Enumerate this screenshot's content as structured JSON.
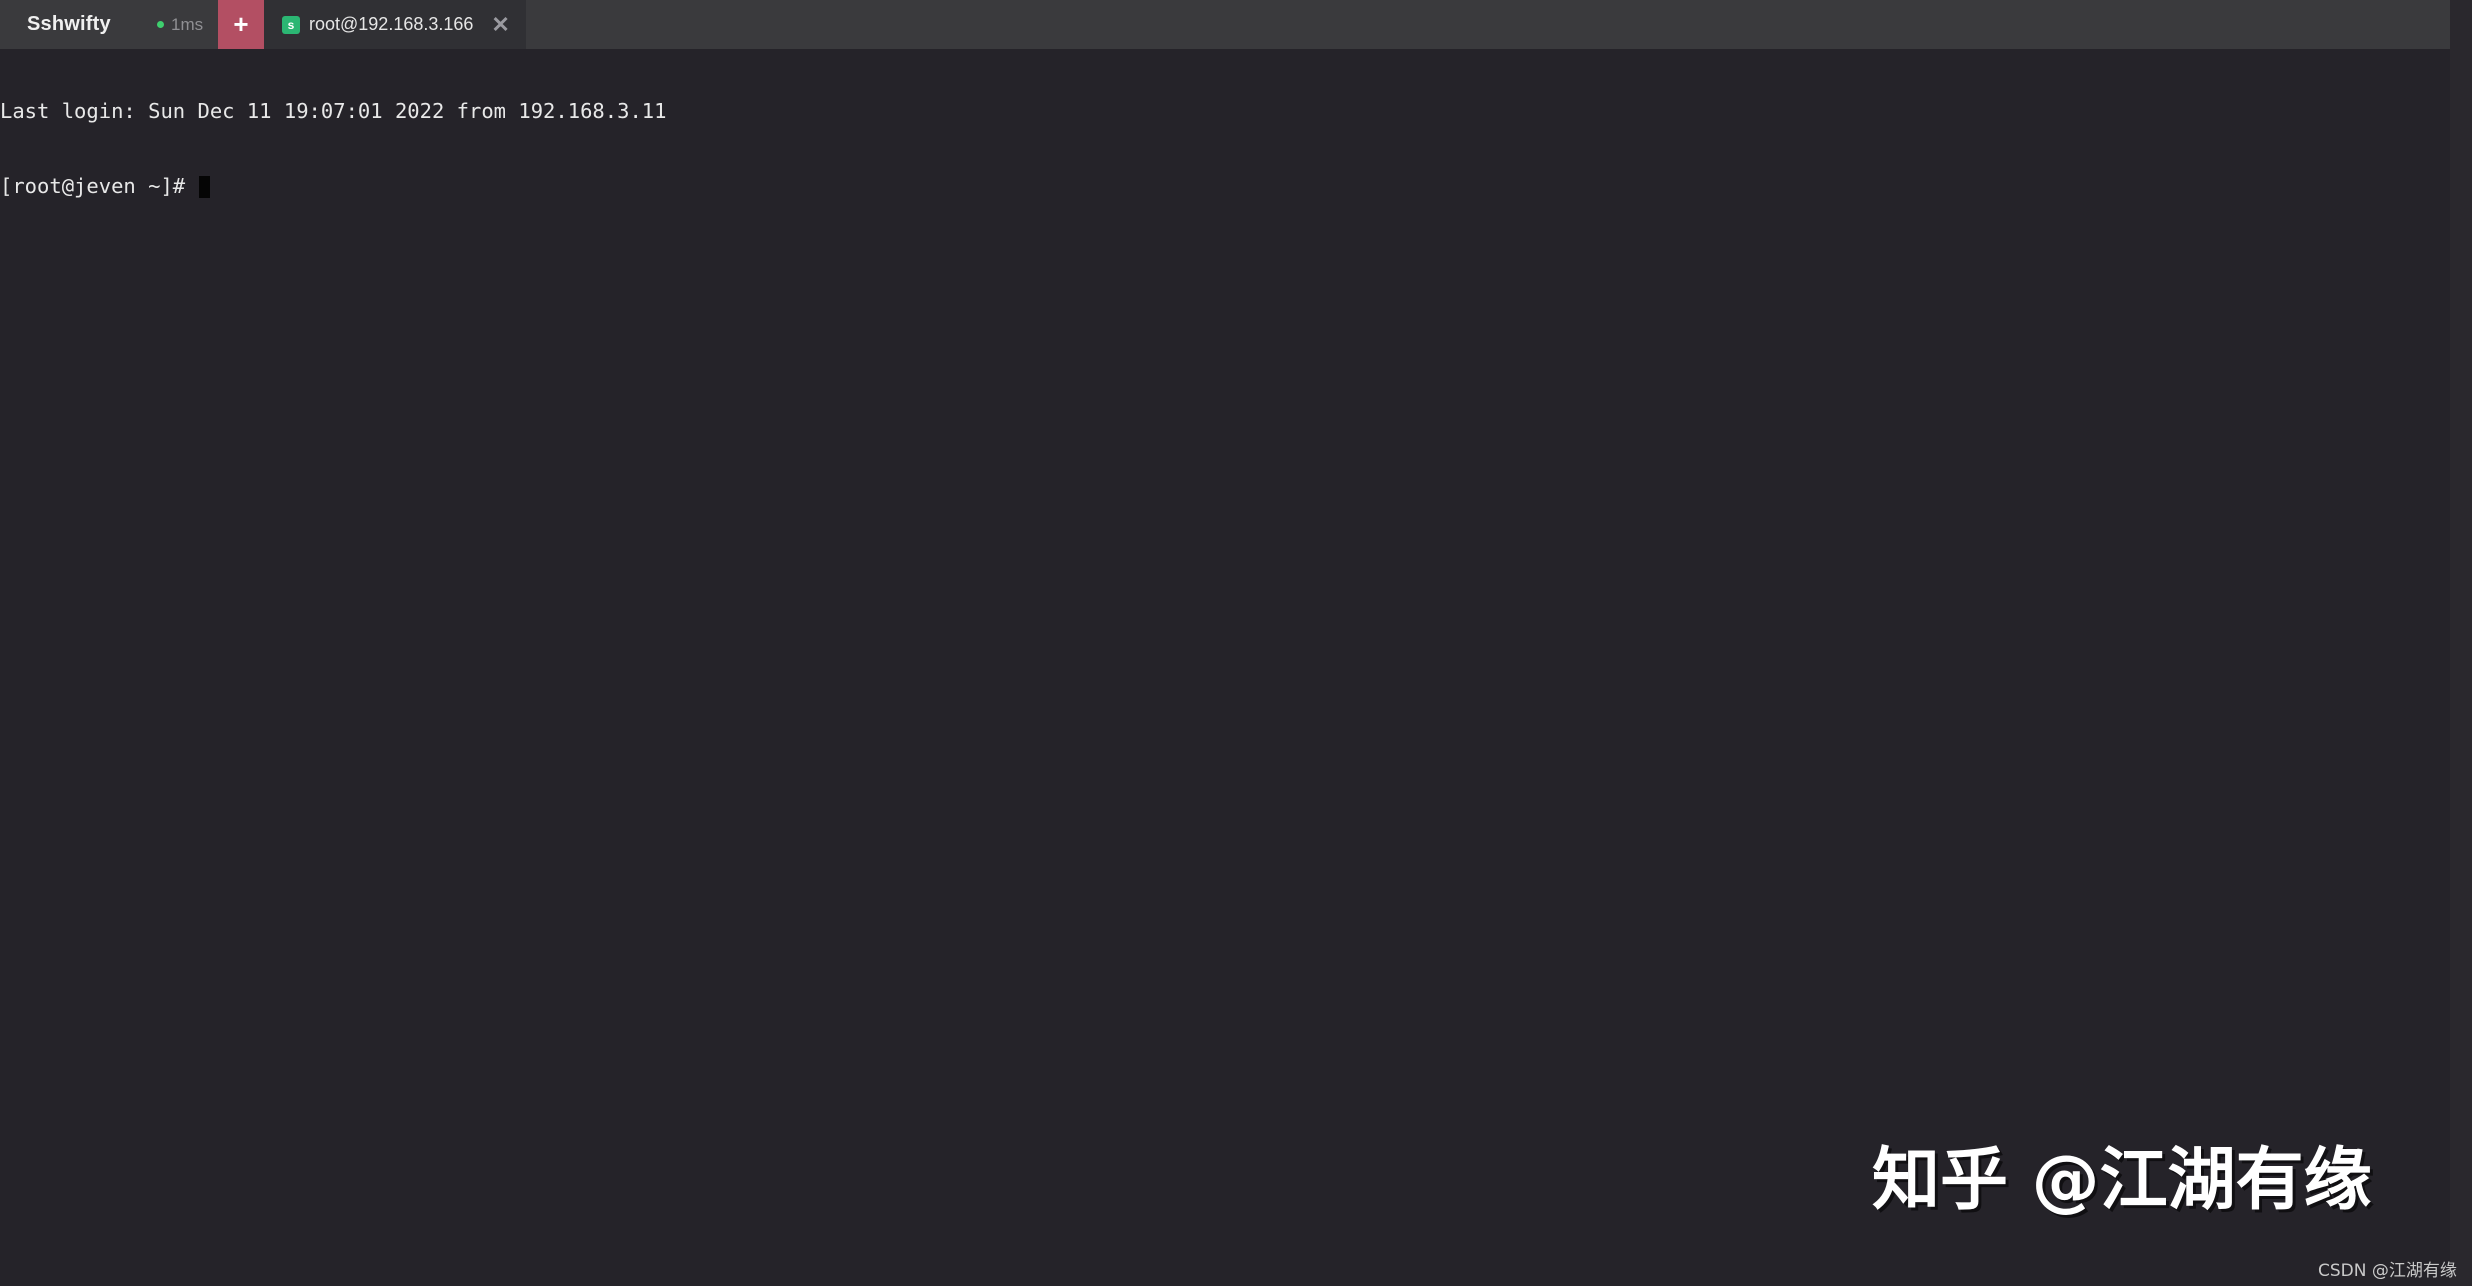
{
  "app": {
    "name": "Sshwifty",
    "latency": "1ms",
    "new_tab_label": "+"
  },
  "tabs": [
    {
      "icon": "s",
      "title": "root@192.168.3.166",
      "close_label": "✕"
    }
  ],
  "terminal": {
    "lines": [
      "Last login: Sun Dec 11 19:07:01 2022 from 192.168.3.11",
      "[root@jeven ~]# "
    ]
  },
  "watermark": {
    "main": "知乎 @江湖有缘",
    "small": "CSDN @江湖有缘"
  },
  "colors": {
    "background": "#252329",
    "topbar": "#3a3a3d",
    "new_tab": "#b34f63",
    "status_dot": "#3ecf6e",
    "tab_icon": "#2bb673"
  }
}
